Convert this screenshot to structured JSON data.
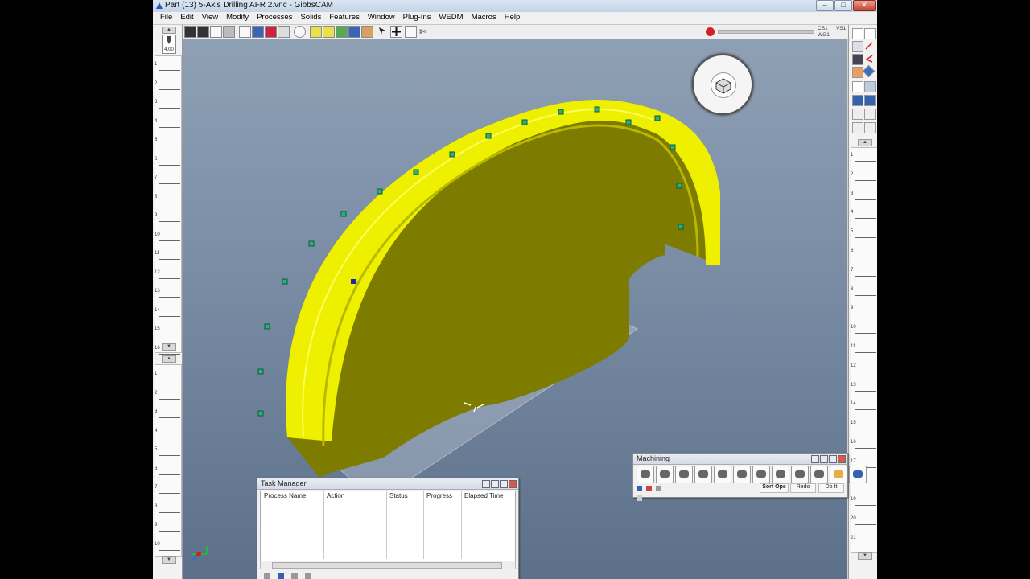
{
  "window": {
    "title": "Part (13) 5-Axis Drilling AFR 2.vnc - GibbsCAM",
    "controls": {
      "minimize": "–",
      "maximize": "□",
      "close": "✕"
    }
  },
  "menu": [
    "File",
    "Edit",
    "View",
    "Modify",
    "Processes",
    "Solids",
    "Features",
    "Window",
    "Plug-Ins",
    "WEDM",
    "Macros",
    "Help"
  ],
  "status": {
    "cs": "CS1",
    "wg": "WG1",
    "vs": "VS1",
    "stop_icon": "stop-sign-icon"
  },
  "left_ruler": {
    "tool_value": "4.00",
    "upper_numbers": [
      "1",
      "2",
      "3",
      "4",
      "5",
      "6",
      "7",
      "8",
      "9",
      "10",
      "11",
      "12",
      "13",
      "14",
      "15",
      "16"
    ],
    "lower_numbers": [
      "1",
      "2",
      "3",
      "4",
      "5",
      "6",
      "7",
      "8",
      "9",
      "10"
    ]
  },
  "right_ruler": {
    "numbers": [
      "1",
      "2",
      "3",
      "4",
      "5",
      "6",
      "7",
      "8",
      "9",
      "10",
      "11",
      "12",
      "13",
      "14",
      "15",
      "16",
      "17",
      "18",
      "19",
      "20",
      "21"
    ]
  },
  "task_manager": {
    "title": "Task Manager",
    "columns": [
      "Process Name",
      "Action",
      "Status",
      "Progress",
      "Elapsed Time"
    ],
    "rows": []
  },
  "machining": {
    "title": "Machining",
    "tool_icons": [
      "hole-pattern-icon",
      "contour-icon",
      "profile-icon",
      "pocket-icon",
      "drill-icon",
      "roughing-icon",
      "5axis-icon",
      "thread-icon",
      "lathe-icon",
      "mill-icon",
      "surface-icon",
      "verify-icon"
    ],
    "buttons": {
      "sort": "Sort Ops",
      "redo": "Redo",
      "do_it": "Do It"
    }
  },
  "colors": {
    "part": "#eef000",
    "part_shade": "#7d7c00",
    "viewport_top": "#8fa0b4",
    "viewport_bottom": "#5d708a",
    "drill_marker": "#2bb07a"
  }
}
